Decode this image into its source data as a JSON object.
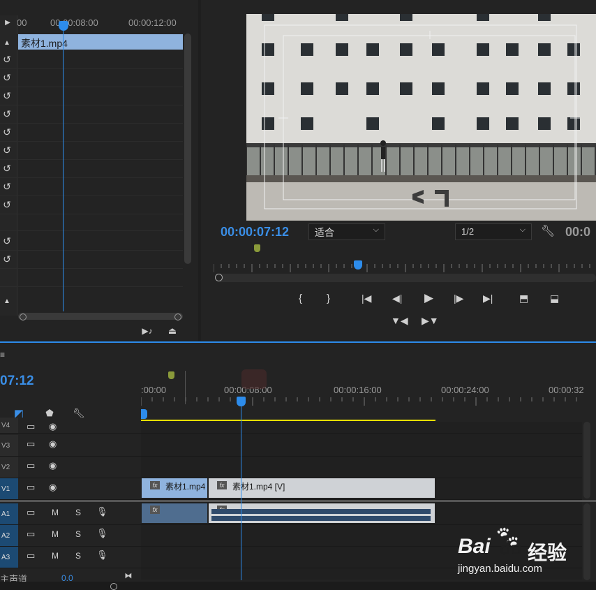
{
  "source": {
    "ruler_left": "00",
    "ruler_mid": "00:00:08:00",
    "ruler_right": "00:00:12:00",
    "clip_name": "素材1.mp4"
  },
  "program": {
    "timecode": "00:00:07:12",
    "fit_label": "适合",
    "resolution_label": "1/2",
    "duration_partial": "00:0"
  },
  "timeline": {
    "timecode": "07:12",
    "ruler": [
      ":00:00",
      "00:00:08:00",
      "00:00:16:00",
      "00:00:24:00",
      "00:00:32"
    ],
    "tracks": [
      "V4",
      "V3",
      "V2",
      "V1",
      "A1",
      "A2",
      "A3"
    ],
    "mix_label": "主声道",
    "mix_value": "0.0",
    "clip_v1a": "素材1.mp4",
    "clip_v1b": "素材1.mp4 [V]",
    "fx": "fx",
    "m": "M",
    "s": "S"
  },
  "watermark": {
    "brand": "Bai",
    "brand2": "du",
    "cn": "经验",
    "url": "jingyan.baidu.com"
  },
  "colors": {
    "accent": "#2d8ceb",
    "clip_video": "#8fb3de",
    "clip_selected": "#cfd2d6",
    "track_active": "#1c4a73",
    "work_area": "#e8e000"
  }
}
